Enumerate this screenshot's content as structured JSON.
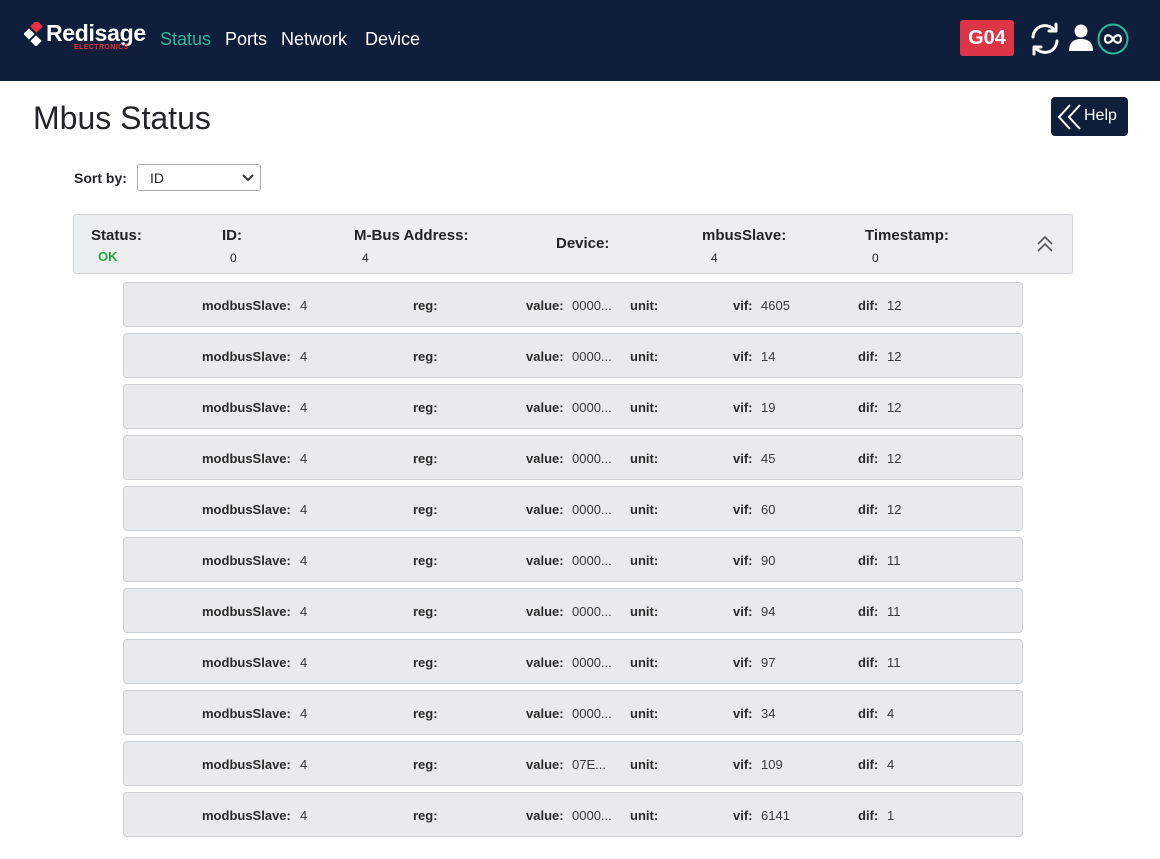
{
  "brand": {
    "name": "Redisage",
    "sub": "ELECTRONICS"
  },
  "nav": [
    {
      "label": "Status",
      "active": true
    },
    {
      "label": "Ports",
      "active": false
    },
    {
      "label": "Network",
      "active": false
    },
    {
      "label": "Device",
      "active": false
    }
  ],
  "gateway_badge": "G04",
  "colors": {
    "navbar": "#0f1e3a",
    "accent": "#29b99a",
    "badge": "#dc3545",
    "ok": "#28a745"
  },
  "icons": [
    "refresh-icon",
    "user-icon",
    "infinity-icon",
    "double-chevron-left-icon",
    "double-chevron-up-icon"
  ],
  "page": {
    "title": "Mbus Status",
    "help_label": "Help"
  },
  "sort": {
    "label": "Sort by:",
    "selected": "ID"
  },
  "device_header": {
    "status_label": "Status:",
    "status_value": "OK",
    "id_label": "ID:",
    "id_value": "0",
    "address_label": "M-Bus Address:",
    "address_value": "4",
    "device_label": "Device:",
    "slave_label": "mbusSlave:",
    "slave_value": "4",
    "timestamp_label": "Timestamp:",
    "timestamp_value": "0"
  },
  "row_labels": {
    "modbus_slave": "modbusSlave:",
    "reg": "reg:",
    "value": "value:",
    "unit": "unit:",
    "vif": "vif:",
    "dif": "dif:"
  },
  "records": [
    {
      "modbus_slave": "4",
      "value": "0000...",
      "vif": "4605",
      "dif": "12"
    },
    {
      "modbus_slave": "4",
      "value": "0000...",
      "vif": "14",
      "dif": "12"
    },
    {
      "modbus_slave": "4",
      "value": "0000...",
      "vif": "19",
      "dif": "12"
    },
    {
      "modbus_slave": "4",
      "value": "0000...",
      "vif": "45",
      "dif": "12"
    },
    {
      "modbus_slave": "4",
      "value": "0000...",
      "vif": "60",
      "dif": "12"
    },
    {
      "modbus_slave": "4",
      "value": "0000...",
      "vif": "90",
      "dif": "11"
    },
    {
      "modbus_slave": "4",
      "value": "0000...",
      "vif": "94",
      "dif": "11"
    },
    {
      "modbus_slave": "4",
      "value": "0000...",
      "vif": "97",
      "dif": "11"
    },
    {
      "modbus_slave": "4",
      "value": "0000...",
      "vif": "34",
      "dif": "4"
    },
    {
      "modbus_slave": "4",
      "value": "07E...",
      "vif": "109",
      "dif": "4"
    },
    {
      "modbus_slave": "4",
      "value": "0000...",
      "vif": "6141",
      "dif": "1"
    }
  ]
}
